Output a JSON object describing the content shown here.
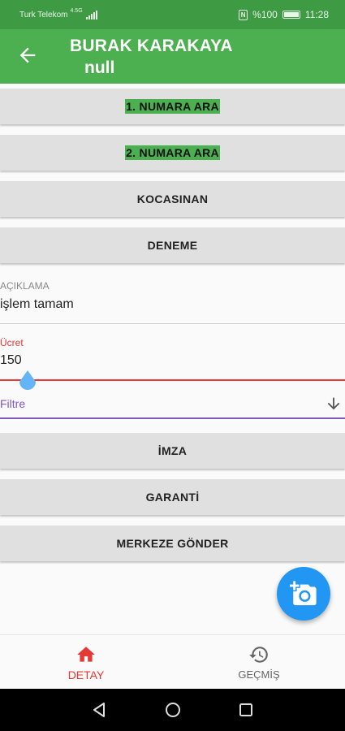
{
  "status_bar": {
    "carrier": "Turk Telekom",
    "network": "4.5G",
    "battery": "%100",
    "time": "11:28"
  },
  "app_bar": {
    "title": "BURAK KARAKAYA",
    "subtitle": "null"
  },
  "buttons": {
    "call_1": "1. NUMARA ARA",
    "call_2": "2. NUMARA ARA",
    "kocasinan": "KOCASINAN",
    "deneme": "DENEME",
    "imza": "İMZA",
    "garanti": "GARANTİ",
    "merkeze": "MERKEZE GÖNDER"
  },
  "fields": {
    "aciklama_label": "AÇIKLAMA",
    "aciklama_value": "işlem tamam",
    "ucret_label": "Ücret",
    "ucret_value": "150",
    "filtre_label": "Filtre"
  },
  "bottom_nav": {
    "detay": "DETAY",
    "gecmis": "GEÇMİŞ"
  },
  "colors": {
    "primary": "#4caf50",
    "primary_dark": "#3f9a44",
    "error": "#e53935",
    "accent": "#2196f3",
    "filter_line": "#7e57c2"
  },
  "icons": [
    "back-arrow-icon",
    "arrow-down-icon",
    "add-photo-icon",
    "home-icon",
    "history-icon",
    "nav-back-icon",
    "nav-home-icon",
    "nav-recents-icon"
  ]
}
